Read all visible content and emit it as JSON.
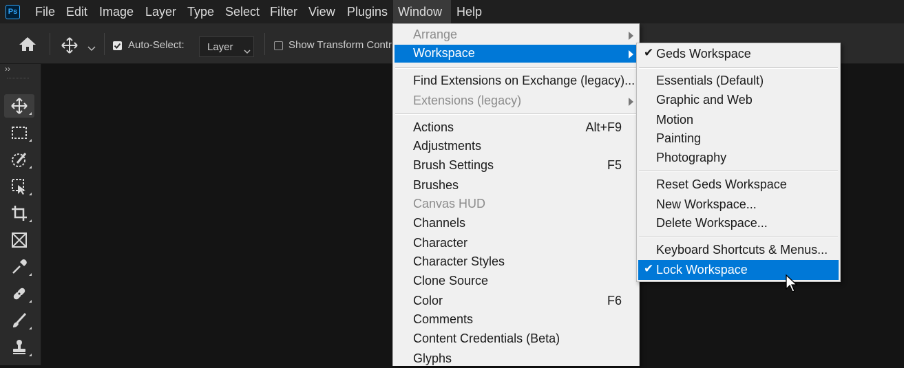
{
  "app": {
    "logo_text": "Ps"
  },
  "menubar": {
    "items": [
      "File",
      "Edit",
      "Image",
      "Layer",
      "Type",
      "Select",
      "Filter",
      "View",
      "Plugins",
      "Window",
      "Help"
    ],
    "active": "Window"
  },
  "options_bar": {
    "auto_select_label": "Auto-Select:",
    "auto_select_checked": true,
    "layer_select_value": "Layer",
    "show_transform_label": "Show Transform Contr",
    "show_transform_checked": false
  },
  "toolbar": {
    "tools": [
      "move-tool",
      "rectangular-marquee-tool",
      "object-selection-tool",
      "frame-select-tool",
      "crop-tool",
      "frame-tool",
      "eyedropper-tool",
      "spot-healing-brush-tool",
      "brush-tool",
      "clone-stamp-tool"
    ],
    "selected": "move-tool"
  },
  "window_menu": {
    "items": [
      {
        "label": "Arrange",
        "disabled": true,
        "submenu": true
      },
      {
        "label": "Workspace",
        "highlighted": true,
        "submenu": true
      },
      {
        "label": "Find Extensions on Exchange (legacy)..."
      },
      {
        "label": "Extensions (legacy)",
        "disabled": true,
        "submenu": true
      },
      {
        "label": "Actions",
        "shortcut": "Alt+F9"
      },
      {
        "label": "Adjustments"
      },
      {
        "label": "Brush Settings",
        "shortcut": "F5"
      },
      {
        "label": "Brushes"
      },
      {
        "label": "Canvas HUD",
        "disabled": true
      },
      {
        "label": "Channels"
      },
      {
        "label": "Character"
      },
      {
        "label": "Character Styles"
      },
      {
        "label": "Clone Source"
      },
      {
        "label": "Color",
        "shortcut": "F6"
      },
      {
        "label": "Comments"
      },
      {
        "label": "Content Credentials (Beta)"
      },
      {
        "label": "Glyphs"
      }
    ]
  },
  "workspace_submenu": {
    "items": [
      {
        "label": "Geds Workspace",
        "checked": true
      },
      {
        "label": "Essentials (Default)"
      },
      {
        "label": "Graphic and Web"
      },
      {
        "label": "Motion"
      },
      {
        "label": "Painting"
      },
      {
        "label": "Photography"
      },
      {
        "label": "Reset Geds Workspace"
      },
      {
        "label": "New Workspace..."
      },
      {
        "label": "Delete Workspace..."
      },
      {
        "label": "Keyboard Shortcuts & Menus..."
      },
      {
        "label": "Lock Workspace",
        "checked": true,
        "highlighted": true
      }
    ],
    "check_glyph": "✔"
  },
  "colors": {
    "highlight": "#0078d7",
    "menu_bg": "#f0f0f0",
    "canvas_bg": "#141414",
    "panel_bg": "#2a2a2a"
  }
}
